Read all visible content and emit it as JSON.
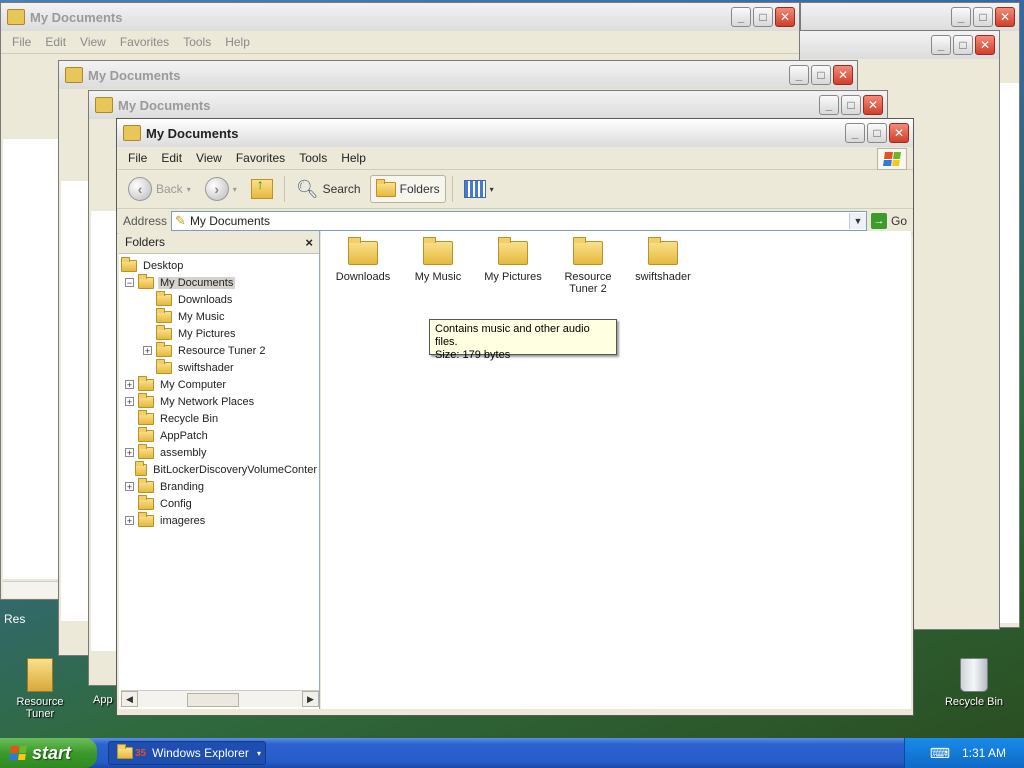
{
  "title": "My Documents",
  "menu": [
    "File",
    "Edit",
    "View",
    "Favorites",
    "Tools",
    "Help"
  ],
  "toolbar": {
    "back": "Back",
    "search": "Search",
    "folders": "Folders"
  },
  "address": {
    "label": "Address",
    "value": "My Documents",
    "go": "Go"
  },
  "folders_pane": {
    "title": "Folders",
    "close": "×"
  },
  "tree": [
    {
      "label": "Desktop",
      "level": 0,
      "exp": "",
      "sel": false
    },
    {
      "label": "My Documents",
      "level": 1,
      "exp": "−",
      "sel": true
    },
    {
      "label": "Downloads",
      "level": 2,
      "exp": "",
      "sel": false
    },
    {
      "label": "My Music",
      "level": 2,
      "exp": "",
      "sel": false
    },
    {
      "label": "My Pictures",
      "level": 2,
      "exp": "",
      "sel": false
    },
    {
      "label": "Resource Tuner 2",
      "level": 2,
      "exp": "+",
      "sel": false
    },
    {
      "label": "swiftshader",
      "level": 2,
      "exp": "",
      "sel": false
    },
    {
      "label": "My Computer",
      "level": 1,
      "exp": "+",
      "sel": false
    },
    {
      "label": "My Network Places",
      "level": 1,
      "exp": "+",
      "sel": false
    },
    {
      "label": "Recycle Bin",
      "level": 1,
      "exp": "",
      "sel": false
    },
    {
      "label": "AppPatch",
      "level": 1,
      "exp": "",
      "sel": false
    },
    {
      "label": "assembly",
      "level": 1,
      "exp": "+",
      "sel": false
    },
    {
      "label": "BitLockerDiscoveryVolumeConter",
      "level": 1,
      "exp": "",
      "sel": false
    },
    {
      "label": "Branding",
      "level": 1,
      "exp": "+",
      "sel": false
    },
    {
      "label": "Config",
      "level": 1,
      "exp": "",
      "sel": false
    },
    {
      "label": "imageres",
      "level": 1,
      "exp": "+",
      "sel": false
    }
  ],
  "items": [
    {
      "label": "Downloads"
    },
    {
      "label": "My Music"
    },
    {
      "label": "My Pictures"
    },
    {
      "label": "Resource Tuner 2"
    },
    {
      "label": "swiftshader"
    }
  ],
  "tooltip": {
    "line1": "Contains music and other audio files.",
    "line2": "Size: 179 bytes"
  },
  "desktop_icons": {
    "left": "Resource Tuner",
    "right": "Recycle Bin"
  },
  "taskbar": {
    "start": "start",
    "item": "Windows Explorer",
    "badge": "35",
    "clock": "1:31 AM"
  },
  "bg_fragments": {
    "res": "Res",
    "app": "App"
  }
}
